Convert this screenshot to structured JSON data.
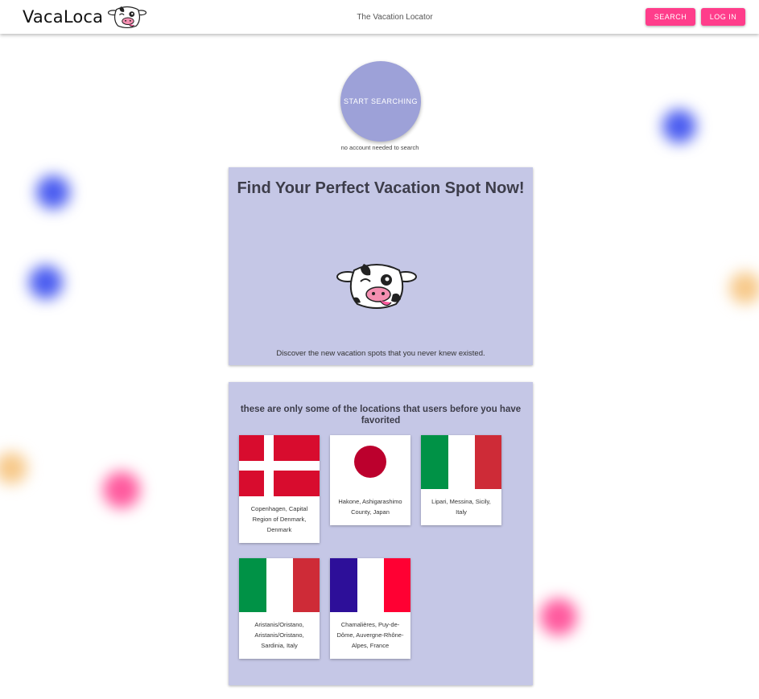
{
  "header": {
    "brand_name": "VacaLoca",
    "subtitle": "The Vacation Locator",
    "search_label": "SEARCH",
    "login_label": "LOG IN"
  },
  "start": {
    "button_label": "START SEARCHING",
    "note": "no account needed to search"
  },
  "hero": {
    "title": "Find Your Perfect Vacation Spot Now!",
    "text": "Discover the new vacation spots that you never knew existed."
  },
  "favorites": {
    "title": "these are only some of the locations that users before you have favorited",
    "locations": [
      {
        "label": "Copenhagen, Capital Region of Denmark, Denmark",
        "flag": "denmark-flag"
      },
      {
        "label": "Hakone, Ashigarashimo County, Japan",
        "flag": "japan-flag"
      },
      {
        "label": "Lipari, Messina, Sicily, Italy",
        "flag": "italy-flag"
      },
      {
        "label": "Aristanis/Oristano, Aristanis/Oristano, Sardinia, Italy",
        "flag": "italy-flag"
      },
      {
        "label": "Chamalières, Puy-de-Dôme, Auvergne-Rhône-Alpes, France",
        "flag": "france-flag"
      }
    ]
  },
  "colors": {
    "accent_pink": "#ff3d8b",
    "panel": "#c5c7e6",
    "start_button": "#9da1d8"
  }
}
